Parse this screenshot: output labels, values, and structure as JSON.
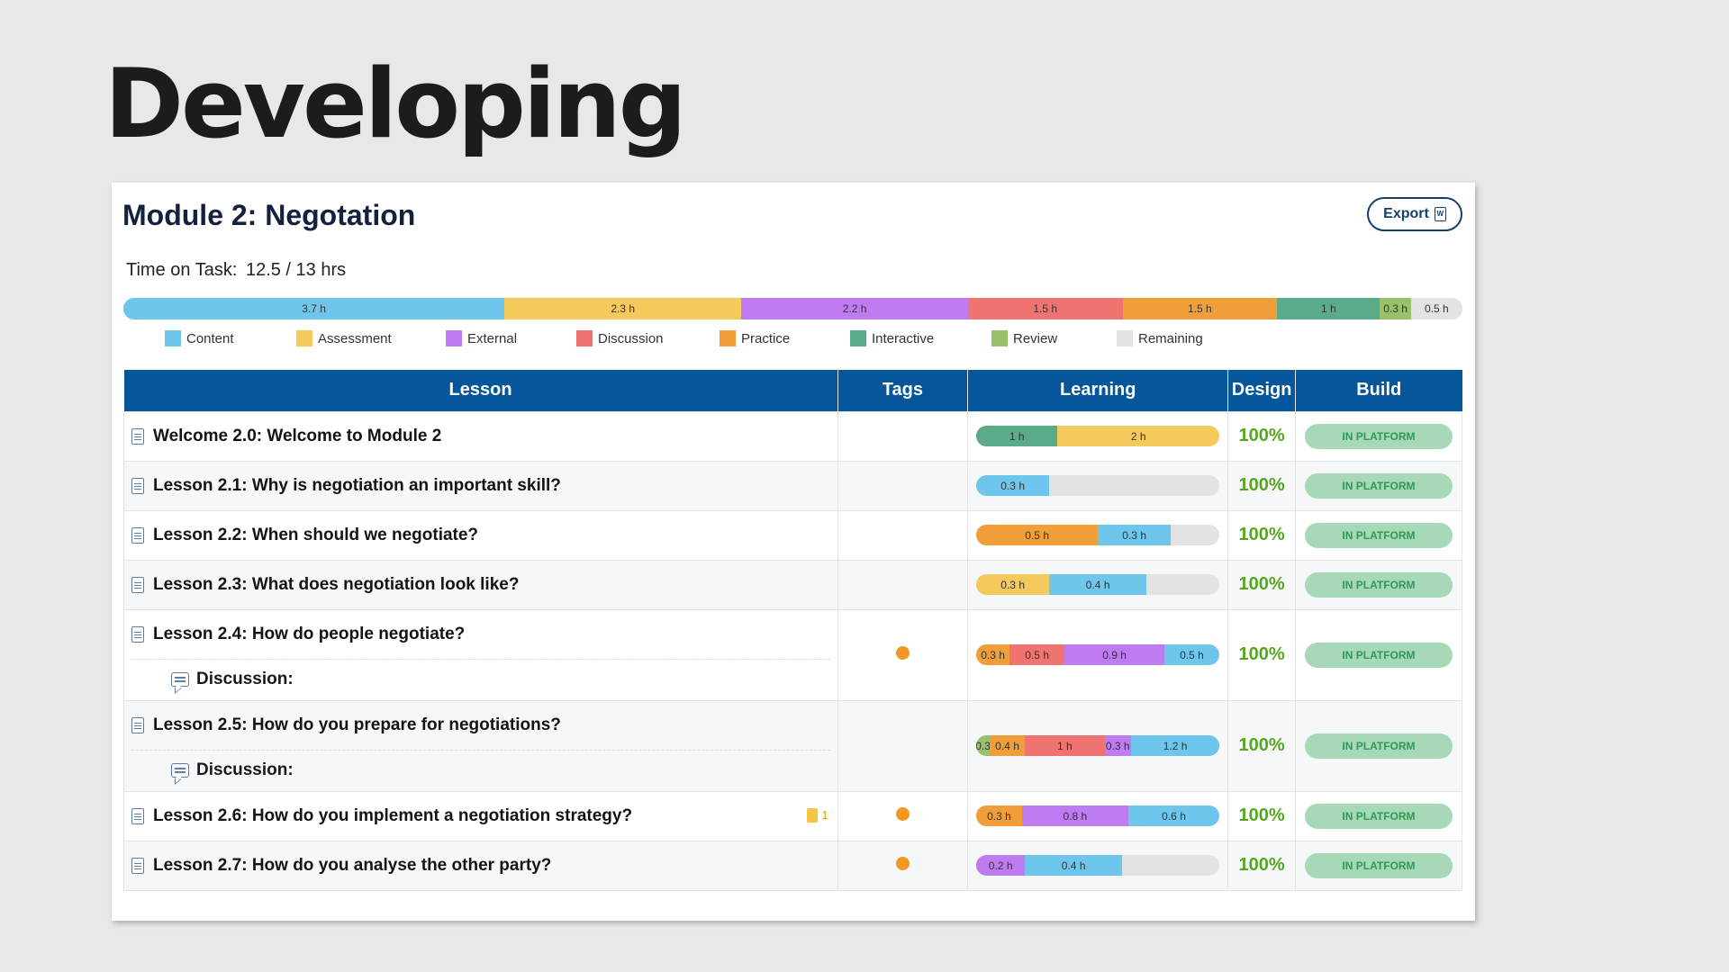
{
  "slide_title": "Developing",
  "module": {
    "title": "Module 2: Negotation",
    "export_label": "Export",
    "time_on_task_label": "Time on Task:",
    "time_on_task_value": "12.5 / 13 hrs"
  },
  "colors": {
    "Content": "#6ec6ec",
    "Assessment": "#f5ca5c",
    "External": "#bf7bf0",
    "Discussion": "#ef7471",
    "Practice": "#ef9e39",
    "Interactive": "#5aab89",
    "Review": "#99c06b",
    "Remaining": "#e3e3e3"
  },
  "total_bar": [
    {
      "category": "Content",
      "hours": 3.7,
      "label": "3.7 h"
    },
    {
      "category": "Assessment",
      "hours": 2.3,
      "label": "2.3 h"
    },
    {
      "category": "External",
      "hours": 2.2,
      "label": "2.2 h"
    },
    {
      "category": "Discussion",
      "hours": 1.5,
      "label": "1.5 h"
    },
    {
      "category": "Practice",
      "hours": 1.5,
      "label": "1.5 h"
    },
    {
      "category": "Interactive",
      "hours": 1,
      "label": "1 h"
    },
    {
      "category": "Review",
      "hours": 0.3,
      "label": "0.3 h"
    },
    {
      "category": "Remaining",
      "hours": 0.5,
      "label": "0.5 h"
    }
  ],
  "legend": [
    "Content",
    "Assessment",
    "External",
    "Discussion",
    "Practice",
    "Interactive",
    "Review",
    "Remaining"
  ],
  "table": {
    "headers": {
      "lesson": "Lesson",
      "tags": "Tags",
      "learning": "Learning",
      "design": "Design",
      "build": "Build"
    },
    "rows": [
      {
        "title": "Welcome 2.0: Welcome to Module 2",
        "sub": null,
        "media": null,
        "tag": false,
        "learning": [
          {
            "category": "Interactive",
            "hours": 1,
            "label": "1 h"
          },
          {
            "category": "Assessment",
            "hours": 2,
            "label": "2 h"
          }
        ],
        "design": "100%",
        "build": "IN PLATFORM"
      },
      {
        "title": "Lesson 2.1: Why is negotiation an important skill?",
        "sub": null,
        "media": null,
        "tag": false,
        "learning": [
          {
            "category": "Content",
            "hours": 0.3,
            "label": "0.3 h"
          }
        ],
        "design": "100%",
        "build": "IN PLATFORM"
      },
      {
        "title": "Lesson 2.2: When should we negotiate?",
        "sub": null,
        "media": null,
        "tag": false,
        "learning": [
          {
            "category": "Practice",
            "hours": 0.5,
            "label": "0.5 h"
          },
          {
            "category": "Content",
            "hours": 0.3,
            "label": "0.3 h"
          }
        ],
        "design": "100%",
        "build": "IN PLATFORM"
      },
      {
        "title": "Lesson 2.3: What does negotiation look like?",
        "sub": null,
        "media": null,
        "tag": false,
        "learning": [
          {
            "category": "Assessment",
            "hours": 0.3,
            "label": "0.3 h"
          },
          {
            "category": "Content",
            "hours": 0.4,
            "label": "0.4 h"
          }
        ],
        "design": "100%",
        "build": "IN PLATFORM"
      },
      {
        "title": "Lesson 2.4: How do people negotiate?",
        "sub": "Discussion:",
        "media": null,
        "tag": true,
        "learning": [
          {
            "category": "Practice",
            "hours": 0.3,
            "label": "0.3 h"
          },
          {
            "category": "Discussion",
            "hours": 0.5,
            "label": "0.5 h"
          },
          {
            "category": "External",
            "hours": 0.9,
            "label": "0.9 h"
          },
          {
            "category": "Content",
            "hours": 0.5,
            "label": "0.5 h"
          }
        ],
        "design": "100%",
        "build": "IN PLATFORM"
      },
      {
        "title": "Lesson 2.5: How do you prepare for negotiations?",
        "sub": "Discussion:",
        "media": null,
        "tag": false,
        "learning": [
          {
            "category": "Review",
            "hours": 0.15,
            "label": "0.3"
          },
          {
            "category": "Practice",
            "hours": 0.4,
            "label": "0.4 h"
          },
          {
            "category": "Discussion",
            "hours": 0.9,
            "label": "1 h"
          },
          {
            "category": "External",
            "hours": 0.3,
            "label": "0.3 h"
          },
          {
            "category": "Content",
            "hours": 1,
            "label": "1.2 h"
          }
        ],
        "design": "100%",
        "build": "IN PLATFORM"
      },
      {
        "title": "Lesson 2.6: How do you implement a negotiation strategy?",
        "sub": null,
        "media": "1",
        "tag": true,
        "learning": [
          {
            "category": "Practice",
            "hours": 0.3,
            "label": "0.3 h"
          },
          {
            "category": "External",
            "hours": 0.7,
            "label": "0.8 h"
          },
          {
            "category": "Content",
            "hours": 0.6,
            "label": "0.6 h"
          }
        ],
        "design": "100%",
        "build": "IN PLATFORM"
      },
      {
        "title": "Lesson 2.7: How do you analyse the other party?",
        "sub": null,
        "media": null,
        "tag": true,
        "learning": [
          {
            "category": "External",
            "hours": 0.2,
            "label": "0.2 h"
          },
          {
            "category": "Content",
            "hours": 0.4,
            "label": "0.4 h"
          }
        ],
        "design": "100%",
        "build": "IN PLATFORM"
      }
    ]
  }
}
